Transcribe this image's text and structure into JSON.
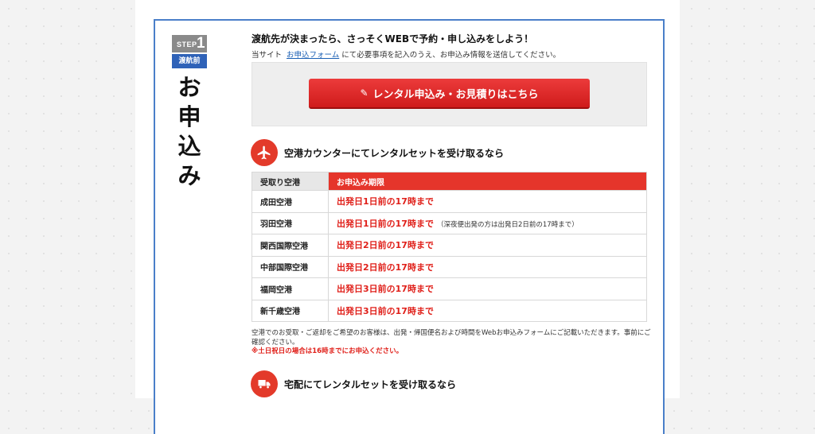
{
  "step": {
    "word": "STEP",
    "number": "1",
    "phase": "渡航前"
  },
  "title_chars": [
    "お",
    "申",
    "込",
    "み"
  ],
  "lead": "渡航先が決まったら、さっそくWEBで予約・申し込みをしよう！",
  "sub": {
    "prefix": "当サイト",
    "link": "お申込フォーム",
    "suffix": "にて必要事項を記入のうえ、お申込み情報を送信してください。"
  },
  "cta": {
    "label": "レンタル申込み・お見積りはこちら",
    "icon": "pencil-icon"
  },
  "airport_section": {
    "icon": "airplane-icon",
    "heading": "空港カウンターにてレンタルセットを受け取るなら"
  },
  "table": {
    "headers": [
      "受取り空港",
      "お申込み期限"
    ],
    "rows": [
      {
        "airport": "成田空港",
        "deadline": "出発日1日前の17時まで",
        "note": ""
      },
      {
        "airport": "羽田空港",
        "deadline": "出発日1日前の17時まで",
        "note": "（深夜便出発の方は出発日2日前の17時まで）"
      },
      {
        "airport": "関西国際空港",
        "deadline": "出発日2日前の17時まで",
        "note": ""
      },
      {
        "airport": "中部国際空港",
        "deadline": "出発日2日前の17時まで",
        "note": ""
      },
      {
        "airport": "福岡空港",
        "deadline": "出発日3日前の17時まで",
        "note": ""
      },
      {
        "airport": "新千歳空港",
        "deadline": "出発日3日前の17時まで",
        "note": ""
      }
    ]
  },
  "footnote": {
    "text": "空港でのお受取・ご返却をご希望のお客様は、出発・帰国便名および時間をWebお申込みフォームにご記載いただきます。事前にご確認ください。",
    "warning": "※土日祝日の場合は16時までにお申込ください。"
  },
  "delivery_section": {
    "icon": "truck-icon",
    "heading": "宅配にてレンタルセットを受け取るなら"
  },
  "colors": {
    "accent_red": "#e33a2a",
    "frame_blue": "#4a7fc9",
    "badge_blue": "#2f62b8",
    "badge_gray": "#8a8a8a"
  }
}
